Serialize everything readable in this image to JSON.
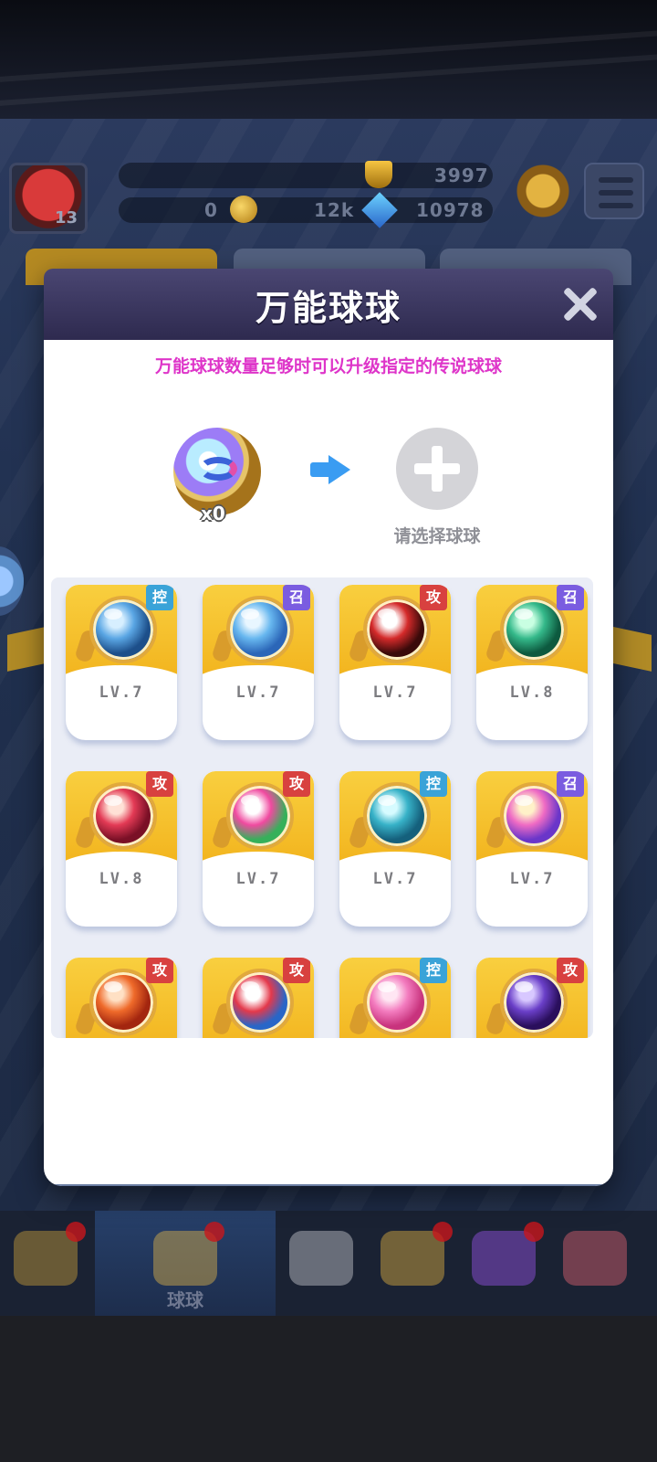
{
  "background": {
    "profile": {
      "level": "13"
    },
    "resources": {
      "trophy_score": "3997",
      "coins": "0",
      "energy": "12k",
      "gems": "10978"
    },
    "bottom_nav": {
      "items": [
        {
          "name": "shop",
          "label": "",
          "has_dot": true,
          "color": "#c9a03a"
        },
        {
          "name": "balls",
          "label": "球球",
          "has_dot": true,
          "color": "#e0b34a",
          "active": true
        },
        {
          "name": "battle",
          "label": "",
          "has_dot": false,
          "color": "#c7c9cf"
        },
        {
          "name": "whistle",
          "label": "",
          "has_dot": true,
          "color": "#e0b140"
        },
        {
          "name": "planet",
          "label": "",
          "has_dot": true,
          "color": "#9a55e8"
        },
        {
          "name": "chat",
          "label": "",
          "has_dot": false,
          "color": "#e06470"
        }
      ]
    }
  },
  "modal": {
    "title": "万能球球",
    "hint": "万能球球数量足够时可以升级指定的传说球球",
    "source": {
      "count_text": "x0"
    },
    "target": {
      "label": "请选择球球"
    },
    "badges": {
      "attack": {
        "text": "攻",
        "color": "#d8413f"
      },
      "control": {
        "text": "控",
        "color": "#3aa3d8"
      },
      "summon": {
        "text": "召",
        "color": "#7a5ce0"
      }
    },
    "balls": [
      {
        "id": "swordsman",
        "type": "control",
        "badge": "控",
        "level": "LV.7",
        "orb": [
          "#d7efff",
          "#5aa6e4",
          "#1d4f8a"
        ]
      },
      {
        "id": "wing",
        "type": "summon",
        "badge": "召",
        "level": "LV.7",
        "orb": [
          "#e8f6ff",
          "#67b7ef",
          "#2b66b8"
        ]
      },
      {
        "id": "venom",
        "type": "attack",
        "badge": "攻",
        "level": "LV.7",
        "orb": [
          "#ffffff",
          "#d42a2a",
          "#3a0a0a"
        ]
      },
      {
        "id": "portal",
        "type": "summon",
        "badge": "召",
        "level": "LV.8",
        "orb": [
          "#c9ffe2",
          "#34b98a",
          "#0d5a3f"
        ]
      },
      {
        "id": "dragon",
        "type": "attack",
        "badge": "攻",
        "level": "LV.8",
        "orb": [
          "#ffe1d6",
          "#e33a55",
          "#7a1026"
        ]
      },
      {
        "id": "prism",
        "type": "attack",
        "badge": "攻",
        "level": "LV.7",
        "orb": [
          "#ffffff",
          "#f04aa0",
          "#36b05a"
        ]
      },
      {
        "id": "wave",
        "type": "control",
        "badge": "控",
        "level": "LV.7",
        "orb": [
          "#d6fbff",
          "#37b2c8",
          "#15607c"
        ]
      },
      {
        "id": "phoenix",
        "type": "summon",
        "badge": "召",
        "level": "LV.7",
        "orb": [
          "#fff1c8",
          "#ef6bc4",
          "#6a36c9"
        ]
      },
      {
        "id": "fist",
        "type": "attack",
        "badge": "攻",
        "level": "",
        "orb": [
          "#ffe0c4",
          "#ef6a2a",
          "#a3260f"
        ]
      },
      {
        "id": "yin-yang",
        "type": "attack",
        "badge": "攻",
        "level": "",
        "orb": [
          "#ffffff",
          "#e4394b",
          "#2866c8"
        ]
      },
      {
        "id": "heart",
        "type": "control",
        "badge": "控",
        "level": "",
        "orb": [
          "#ffe6f3",
          "#f37cbf",
          "#c8337d"
        ]
      },
      {
        "id": "blade",
        "type": "attack",
        "badge": "攻",
        "level": "",
        "orb": [
          "#d8c8ff",
          "#6a3fc8",
          "#2a0f5c"
        ]
      }
    ]
  }
}
